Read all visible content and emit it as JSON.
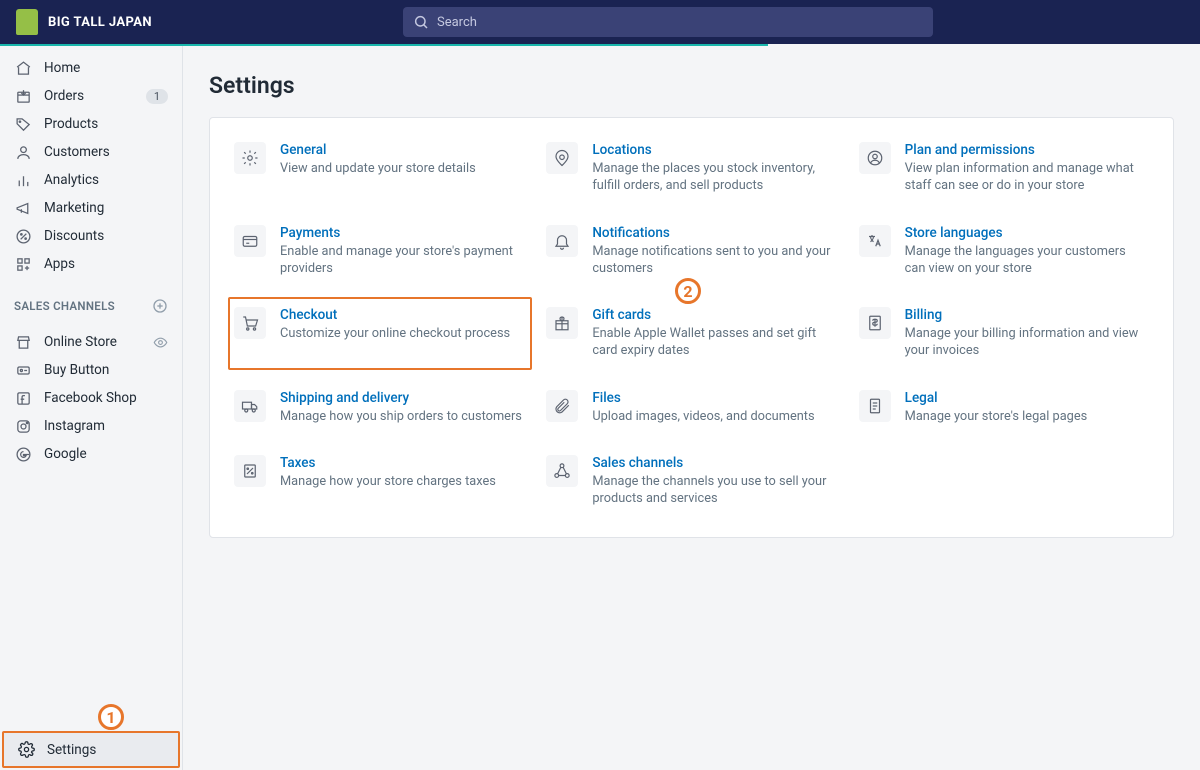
{
  "header": {
    "store_name": "BIG TALL JAPAN",
    "search_placeholder": "Search"
  },
  "nav": {
    "items": [
      {
        "label": "Home",
        "icon": "home"
      },
      {
        "label": "Orders",
        "icon": "orders",
        "badge": "1"
      },
      {
        "label": "Products",
        "icon": "products"
      },
      {
        "label": "Customers",
        "icon": "customers"
      },
      {
        "label": "Analytics",
        "icon": "analytics"
      },
      {
        "label": "Marketing",
        "icon": "marketing"
      },
      {
        "label": "Discounts",
        "icon": "discounts"
      },
      {
        "label": "Apps",
        "icon": "apps"
      }
    ],
    "channels_heading": "SALES CHANNELS",
    "channels": [
      {
        "label": "Online Store",
        "tail": "eye"
      },
      {
        "label": "Buy Button"
      },
      {
        "label": "Facebook Shop"
      },
      {
        "label": "Instagram"
      },
      {
        "label": "Google"
      }
    ],
    "settings_label": "Settings"
  },
  "page": {
    "title": "Settings"
  },
  "tiles": [
    {
      "title": "General",
      "desc": "View and update your store details",
      "icon": "gear"
    },
    {
      "title": "Locations",
      "desc": "Manage the places you stock inventory, fulfill orders, and sell products",
      "icon": "location"
    },
    {
      "title": "Plan and permissions",
      "desc": "View plan information and manage what staff can see or do in your store",
      "icon": "user-circle"
    },
    {
      "title": "Payments",
      "desc": "Enable and manage your store's payment providers",
      "icon": "payments"
    },
    {
      "title": "Notifications",
      "desc": "Manage notifications sent to you and your customers",
      "icon": "bell"
    },
    {
      "title": "Store languages",
      "desc": "Manage the languages your customers can view on your store",
      "icon": "languages"
    },
    {
      "title": "Checkout",
      "desc": "Customize your online checkout process",
      "icon": "cart",
      "highlight": true
    },
    {
      "title": "Gift cards",
      "desc": "Enable Apple Wallet passes and set gift card expiry dates",
      "icon": "gift"
    },
    {
      "title": "Billing",
      "desc": "Manage your billing information and view your invoices",
      "icon": "billing"
    },
    {
      "title": "Shipping and delivery",
      "desc": "Manage how you ship orders to customers",
      "icon": "truck"
    },
    {
      "title": "Files",
      "desc": "Upload images, videos, and documents",
      "icon": "clip"
    },
    {
      "title": "Legal",
      "desc": "Manage your store's legal pages",
      "icon": "legal"
    },
    {
      "title": "Taxes",
      "desc": "Manage how your store charges taxes",
      "icon": "taxes"
    },
    {
      "title": "Sales channels",
      "desc": "Manage the channels you use to sell your products and services",
      "icon": "channels"
    }
  ],
  "annotations": {
    "one": "1",
    "two": "2"
  }
}
